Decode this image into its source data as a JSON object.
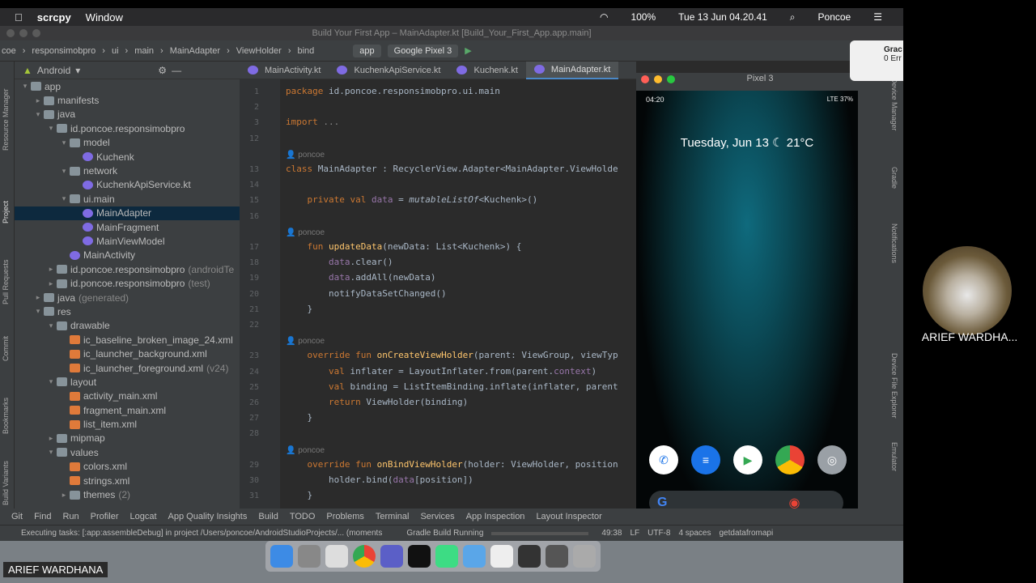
{
  "menubar": {
    "app": "scrcpy",
    "window": "Window",
    "battery": "100%",
    "datetime": "Tue 13 Jun  04.20.41",
    "user": "Poncoe"
  },
  "window_title": "Build Your First App – MainAdapter.kt [Build_Your_First_App.app.main]",
  "breadcrumb": [
    "coe",
    "responsimobpro",
    "ui",
    "main",
    "MainAdapter",
    "ViewHolder",
    "bind"
  ],
  "run_config": "app",
  "device": "Google Pixel 3",
  "project": {
    "view": "Android",
    "items": [
      {
        "t": "app",
        "d": 0,
        "a": "▾",
        "ic": "folder"
      },
      {
        "t": "manifests",
        "d": 1,
        "a": "▸",
        "ic": "folder"
      },
      {
        "t": "java",
        "d": 1,
        "a": "▾",
        "ic": "folder"
      },
      {
        "t": "id.poncoe.responsimobpro",
        "d": 2,
        "a": "▾",
        "ic": "folder"
      },
      {
        "t": "model",
        "d": 3,
        "a": "▾",
        "ic": "folder"
      },
      {
        "t": "Kuchenk",
        "d": 4,
        "a": "",
        "ic": "kt"
      },
      {
        "t": "network",
        "d": 3,
        "a": "▾",
        "ic": "folder"
      },
      {
        "t": "KuchenkApiService.kt",
        "d": 4,
        "a": "",
        "ic": "kt"
      },
      {
        "t": "ui.main",
        "d": 3,
        "a": "▾",
        "ic": "folder"
      },
      {
        "t": "MainAdapter",
        "d": 4,
        "a": "",
        "ic": "kt",
        "sel": true
      },
      {
        "t": "MainFragment",
        "d": 4,
        "a": "",
        "ic": "kt"
      },
      {
        "t": "MainViewModel",
        "d": 4,
        "a": "",
        "ic": "kt"
      },
      {
        "t": "MainActivity",
        "d": 3,
        "a": "",
        "ic": "kt"
      },
      {
        "t": "id.poncoe.responsimobpro",
        "d": 2,
        "a": "▸",
        "ic": "folder",
        "suffix": "(androidTe"
      },
      {
        "t": "id.poncoe.responsimobpro",
        "d": 2,
        "a": "▸",
        "ic": "folder",
        "suffix": "(test)"
      },
      {
        "t": "java",
        "d": 1,
        "a": "▸",
        "ic": "folder",
        "suffix": "(generated)"
      },
      {
        "t": "res",
        "d": 1,
        "a": "▾",
        "ic": "folder"
      },
      {
        "t": "drawable",
        "d": 2,
        "a": "▾",
        "ic": "folder"
      },
      {
        "t": "ic_baseline_broken_image_24.xml",
        "d": 3,
        "a": "",
        "ic": "xml"
      },
      {
        "t": "ic_launcher_background.xml",
        "d": 3,
        "a": "",
        "ic": "xml"
      },
      {
        "t": "ic_launcher_foreground.xml",
        "d": 3,
        "a": "",
        "ic": "xml",
        "suffix": "(v24)"
      },
      {
        "t": "layout",
        "d": 2,
        "a": "▾",
        "ic": "folder"
      },
      {
        "t": "activity_main.xml",
        "d": 3,
        "a": "",
        "ic": "xml"
      },
      {
        "t": "fragment_main.xml",
        "d": 3,
        "a": "",
        "ic": "xml"
      },
      {
        "t": "list_item.xml",
        "d": 3,
        "a": "",
        "ic": "xml"
      },
      {
        "t": "mipmap",
        "d": 2,
        "a": "▸",
        "ic": "folder"
      },
      {
        "t": "values",
        "d": 2,
        "a": "▾",
        "ic": "folder"
      },
      {
        "t": "colors.xml",
        "d": 3,
        "a": "",
        "ic": "xml"
      },
      {
        "t": "strings.xml",
        "d": 3,
        "a": "",
        "ic": "xml"
      },
      {
        "t": "themes",
        "d": 3,
        "a": "▸",
        "ic": "folder",
        "suffix": "(2)"
      }
    ]
  },
  "tabs": [
    "MainActivity.kt",
    "KuchenkApiService.kt",
    "Kuchenk.kt",
    "MainAdapter.kt"
  ],
  "code": [
    {
      "n": "1",
      "h": "<span class='kw'>package</span> id.poncoe.responsimobpro.ui.main"
    },
    {
      "n": "2",
      "h": ""
    },
    {
      "n": "3",
      "h": "<span class='kw'>import</span> <span class='muted'>...</span>"
    },
    {
      "n": "12",
      "h": ""
    },
    {
      "hint": "👤 poncoe"
    },
    {
      "n": "13",
      "h": "<span class='kw'>class</span> MainAdapter : RecyclerView.Adapter&lt;MainAdapter.ViewHolde"
    },
    {
      "n": "14",
      "h": ""
    },
    {
      "n": "15",
      "h": "    <span class='kw'>private val</span> <span class='pr'>data</span> = <span class='it'>mutableListOf</span>&lt;Kuchenk&gt;()"
    },
    {
      "n": "16",
      "h": ""
    },
    {
      "hint": "    👤 poncoe"
    },
    {
      "n": "17",
      "h": "    <span class='kw'>fun</span> <span class='fn'>updateData</span>(newData: List&lt;Kuchenk&gt;) {"
    },
    {
      "n": "18",
      "h": "        <span class='pr'>data</span>.clear()"
    },
    {
      "n": "19",
      "h": "        <span class='pr'>data</span>.addAll(newData)"
    },
    {
      "n": "20",
      "h": "        notifyDataSetChanged()"
    },
    {
      "n": "21",
      "h": "    }"
    },
    {
      "n": "22",
      "h": ""
    },
    {
      "hint": "    👤 poncoe"
    },
    {
      "n": "23",
      "h": "    <span class='kw'>override fun</span> <span class='fn'>onCreateViewHolder</span>(parent: ViewGroup, viewTyp"
    },
    {
      "n": "24",
      "h": "        <span class='kw'>val</span> inflater = LayoutInflater.from(parent.<span class='pr'>context</span>)"
    },
    {
      "n": "25",
      "h": "        <span class='kw'>val</span> binding = ListItemBinding.inflate(inflater, parent"
    },
    {
      "n": "26",
      "h": "        <span class='kw'>return</span> ViewHolder(binding)"
    },
    {
      "n": "27",
      "h": "    }"
    },
    {
      "n": "28",
      "h": ""
    },
    {
      "hint": "    👤 poncoe"
    },
    {
      "n": "29",
      "h": "    <span class='kw'>override fun</span> <span class='fn'>onBindViewHolder</span>(holder: ViewHolder, position"
    },
    {
      "n": "30",
      "h": "        holder.bind(<span class='pr'>data</span>[position])"
    },
    {
      "n": "31",
      "h": "    }"
    }
  ],
  "emulator": {
    "title": "Pixel 3",
    "time": "04:20",
    "status_right": "LTE 37%",
    "date": "Tuesday, Jun 13",
    "temp": "21°C"
  },
  "gradle_note": {
    "title": "Grac",
    "sub": "0 Err"
  },
  "bottom_tools": [
    "Git",
    "Find",
    "Run",
    "Profiler",
    "Logcat",
    "App Quality Insights",
    "Build",
    "TODO",
    "Problems",
    "Terminal",
    "Services",
    "App Inspection",
    "Layout Inspector"
  ],
  "status": {
    "task": "Executing tasks: [:app:assembleDebug] in project /Users/poncoe/AndroidStudioProjects/... (moments",
    "gradle": "Gradle Build Running",
    "pos": "49:38",
    "lf": "LF",
    "enc": "UTF-8",
    "indent": "4 spaces",
    "branch": "getdatafromapi"
  },
  "left_tools": [
    "Resource Manager",
    "Project",
    "Pull Requests",
    "Commit",
    "Bookmarks",
    "Build Variants"
  ],
  "right_tools": [
    "Device Manager",
    "Gradle",
    "Notifications",
    "Device File Explorer",
    "Emulator"
  ],
  "participant": {
    "name": "ARIEF WARDHA..."
  },
  "presenter": {
    "name": "ARIEF WARDHANA"
  }
}
